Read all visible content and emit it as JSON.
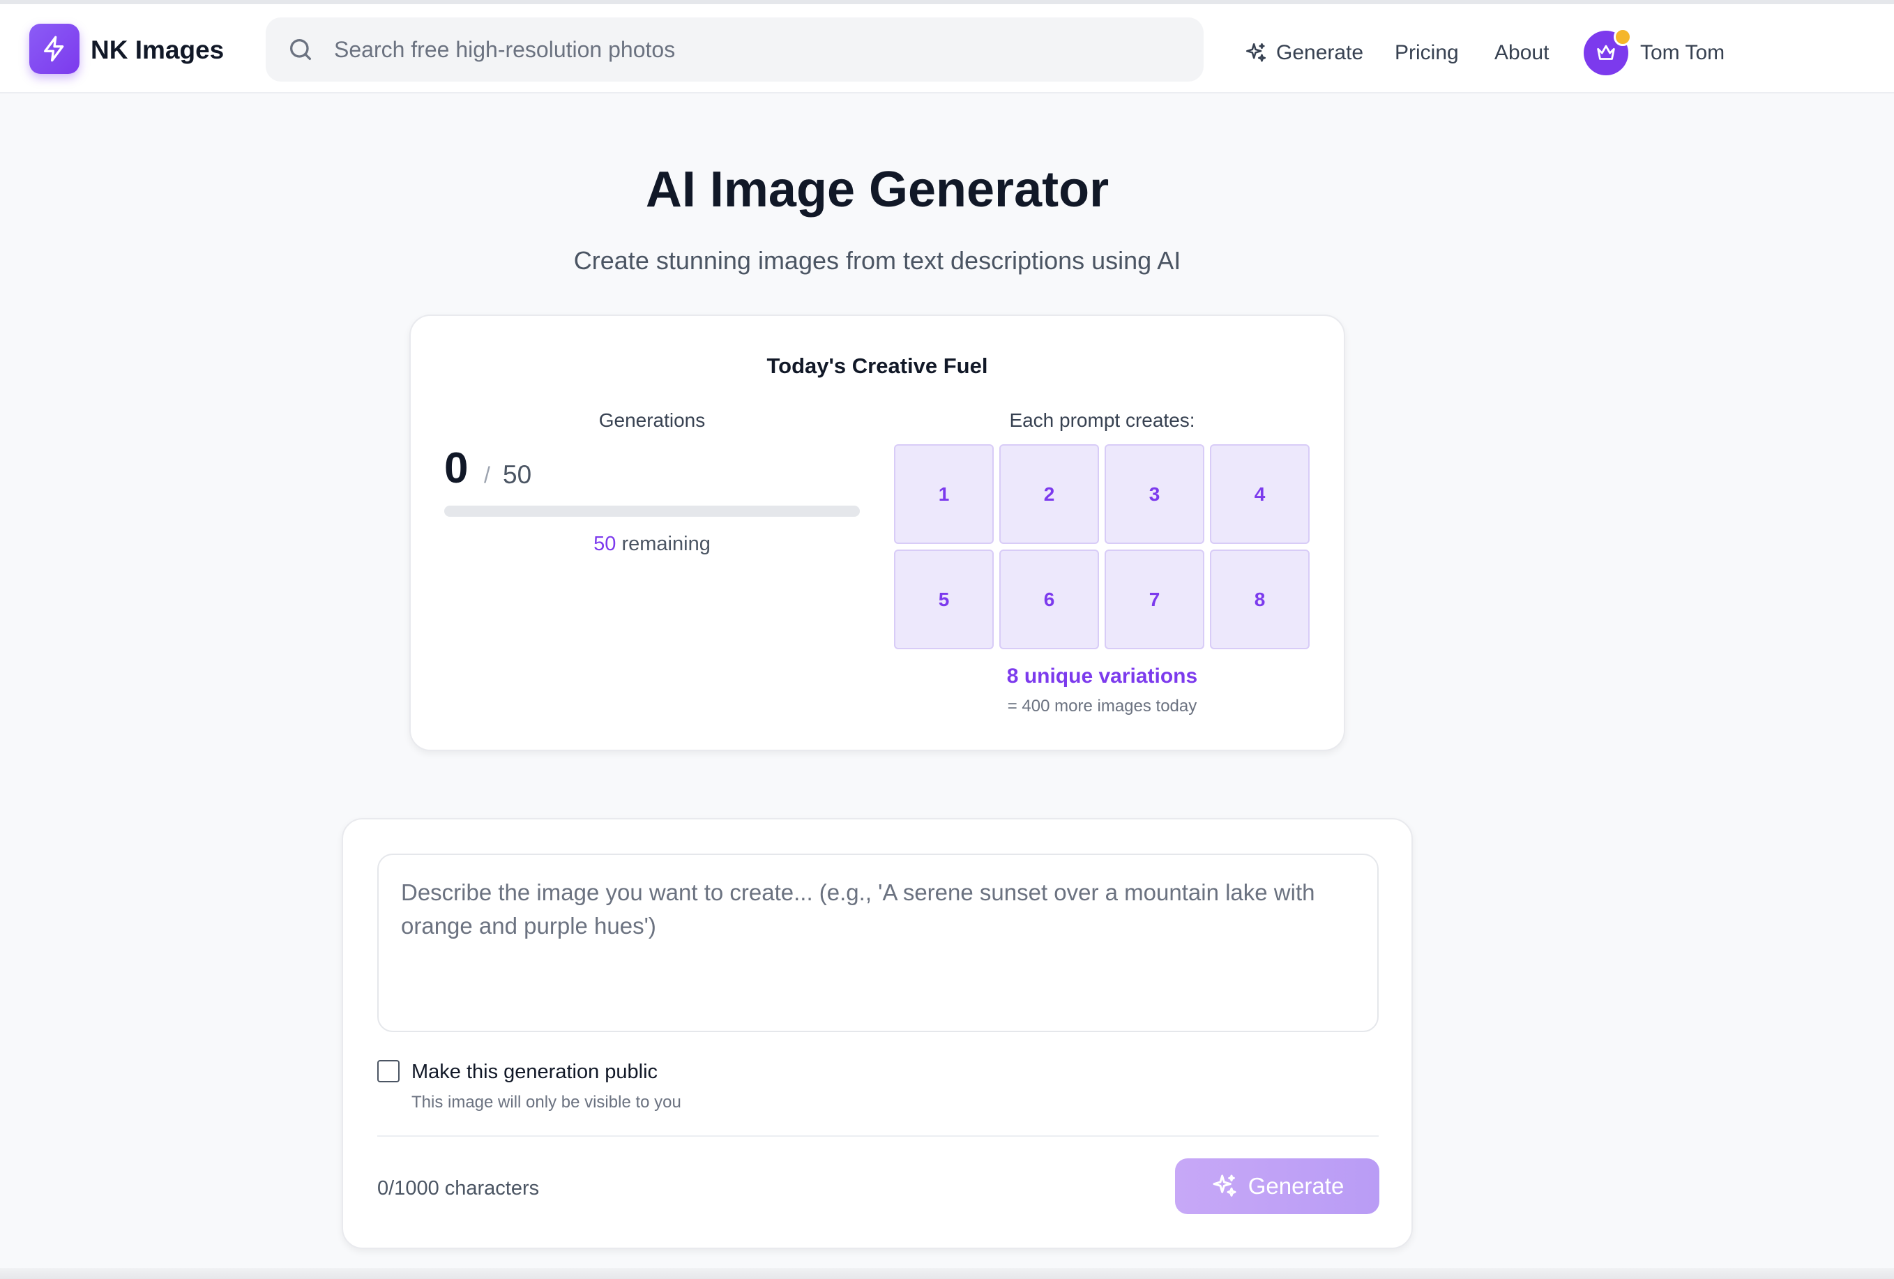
{
  "header": {
    "logo_text": "NK Images",
    "search_placeholder": "Search free high-resolution photos",
    "nav": {
      "generate": "Generate",
      "pricing": "Pricing",
      "about": "About"
    },
    "user_name": "Tom Tom"
  },
  "page": {
    "title": "AI Image Generator",
    "subtitle": "Create stunning images from text descriptions using AI"
  },
  "fuel": {
    "title": "Today's Creative Fuel",
    "generations_label": "Generations",
    "used": "0",
    "slash": "/",
    "total": "50",
    "progress_fraction": 0,
    "remaining_count": "50",
    "remaining_label": "remaining",
    "each_prompt_label": "Each prompt creates:",
    "variations": [
      "1",
      "2",
      "3",
      "4",
      "5",
      "6",
      "7",
      "8"
    ],
    "variations_summary": "8 unique variations",
    "more_images": "= 400 more images today"
  },
  "prompt": {
    "placeholder": "Describe the image you want to create... (e.g., 'A serene sunset over a mountain lake with orange and purple hues')",
    "public_label": "Make this generation public",
    "public_hint": "This image will only be visible to you",
    "char_count": "0/1000 characters",
    "generate_label": "Generate"
  },
  "colors": {
    "accent": "#7c3aed",
    "tile_bg": "#ede8fc",
    "button_disabled": "#c4a6f7",
    "badge": "#f5b62a"
  },
  "icons": {
    "logo": "lightning-bolt-icon",
    "search": "search-icon",
    "generate": "sparkle-icon",
    "avatar": "crown-icon"
  }
}
